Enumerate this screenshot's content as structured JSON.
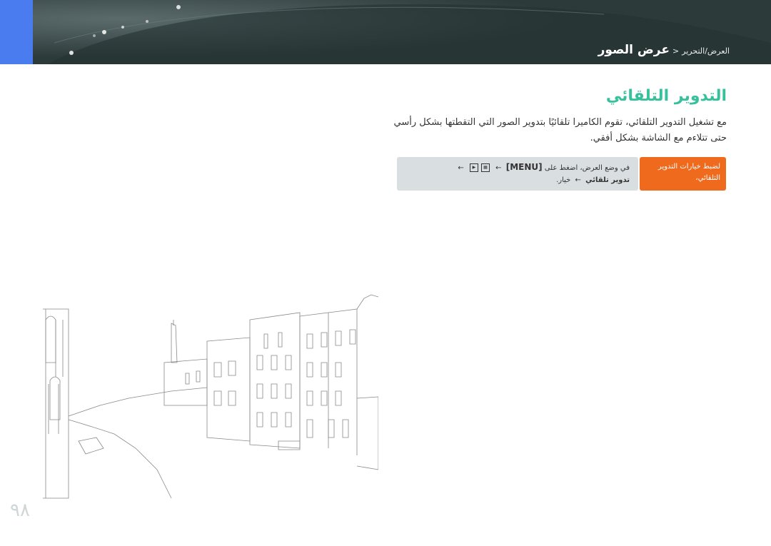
{
  "header": {
    "title": "عرض الصور",
    "separator": "<",
    "parent": "العرض/التحرير"
  },
  "page_title": "التدوير التلقائي",
  "description": "مع تشغيل التدوير التلقائي، تقوم الكاميرا تلقائيًا بتدوير الصور التي التقطتها بشكل رأسي حتى تتلاءم مع الشاشة بشكل أفقي.",
  "info": {
    "label": "لضبط خيارات التدوير التلقائي،",
    "line1_prefix": "في وضع العرض، اضغط على",
    "menu_key": "[MENU]",
    "arrow": "←",
    "line2_bold": "تدوير تلقائي",
    "line2_suffix": "خيار."
  },
  "page_number": "٩٨",
  "colors": {
    "header_bg": "#2d3a3a",
    "accent_blue": "#4a7cf0",
    "title_green": "#36c19c",
    "label_orange": "#f06a1d",
    "info_gray": "#d9dfe1"
  }
}
